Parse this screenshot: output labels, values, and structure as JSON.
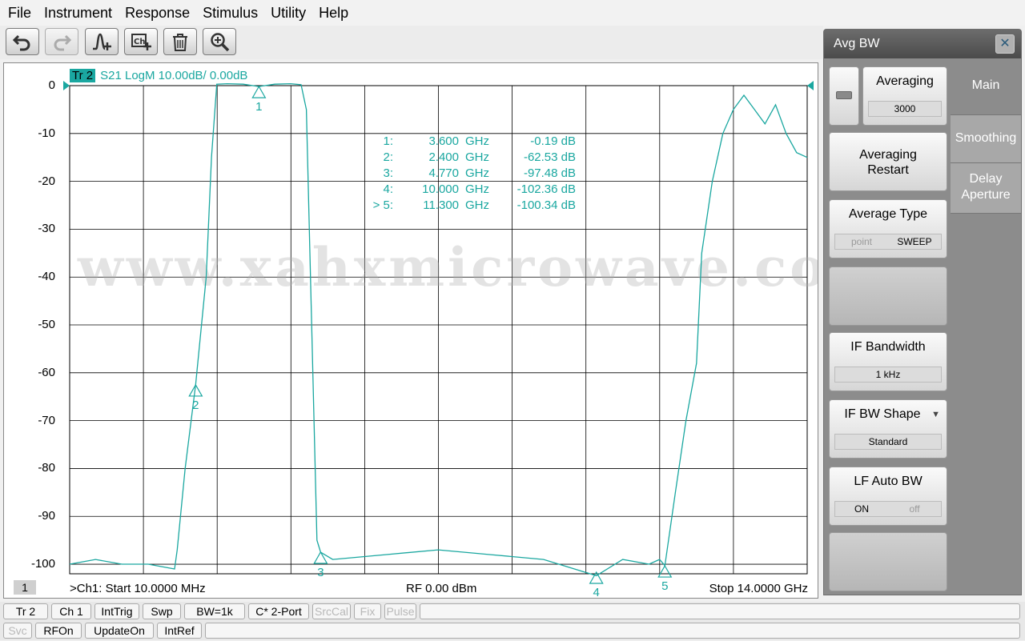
{
  "menu": [
    "File",
    "Instrument",
    "Response",
    "Stimulus",
    "Utility",
    "Help"
  ],
  "toolbar": {
    "buttons": [
      {
        "name": "undo",
        "icon": "undo-arrow-icon"
      },
      {
        "name": "redo",
        "icon": "redo-arrow-icon"
      },
      {
        "name": "add-marker",
        "icon": "marker-plus-icon"
      },
      {
        "name": "add-channel",
        "icon": "channel-plus-icon"
      },
      {
        "name": "delete",
        "icon": "trash-icon"
      },
      {
        "name": "zoom",
        "icon": "zoom-in-icon"
      }
    ]
  },
  "trace": {
    "tag": "Tr 2",
    "description": "S21 LogM 10.00dB/  0.00dB",
    "color": "#1aa7a0"
  },
  "chart_data": {
    "type": "line",
    "x_unit": "GHz",
    "y_unit": "dB",
    "xlim": [
      0.01,
      14.0
    ],
    "ylim": [
      -102,
      0
    ],
    "y_ticks": [
      "0",
      "-10",
      "-20",
      "-30",
      "-40",
      "-50",
      "-60",
      "-70",
      "-80",
      "-90",
      "-100"
    ],
    "y_tick_values": [
      0,
      -10,
      -20,
      -30,
      -40,
      -50,
      -60,
      -70,
      -80,
      -90,
      -100
    ],
    "x_divisions": 10,
    "grid": true,
    "series": [
      {
        "x": [
          0.01,
          0.5,
          1.0,
          1.5,
          2.0,
          2.05,
          2.2,
          2.4,
          2.6,
          2.7,
          2.8,
          3.0,
          3.3,
          3.6,
          3.9,
          4.2,
          4.4,
          4.5,
          4.6,
          4.7,
          4.77,
          5.0,
          6.0,
          7.0,
          8.0,
          9.0,
          10.0,
          10.5,
          11.0,
          11.2,
          11.3,
          11.5,
          11.7,
          11.9,
          12.0,
          12.2,
          12.4,
          12.6,
          12.8,
          13.0,
          13.2,
          13.4,
          13.6,
          13.8,
          14.0
        ],
        "y": [
          -100,
          -99,
          -100,
          -100,
          -101,
          -97,
          -80,
          -62.5,
          -40,
          -15,
          0.3,
          0.4,
          0.3,
          -0.19,
          0.3,
          0.4,
          0.2,
          -5,
          -50,
          -95,
          -97.5,
          -99,
          -98,
          -97,
          -98,
          -99,
          -102.4,
          -99,
          -100,
          -99,
          -100.3,
          -85,
          -70,
          -58,
          -35,
          -20,
          -10,
          -5,
          -2,
          -5,
          -8,
          -4,
          -10,
          -14,
          -15
        ]
      }
    ],
    "markers": [
      {
        "id": "1:",
        "label": "1",
        "freq": "3.600",
        "unit": "GHz",
        "value": "-0.19 dB",
        "x": 3.6,
        "y": -0.19
      },
      {
        "id": "2:",
        "label": "2",
        "freq": "2.400",
        "unit": "GHz",
        "value": "-62.53 dB",
        "x": 2.4,
        "y": -62.53
      },
      {
        "id": "3:",
        "label": "3",
        "freq": "4.770",
        "unit": "GHz",
        "value": "-97.48 dB",
        "x": 4.77,
        "y": -97.48
      },
      {
        "id": "4:",
        "label": "4",
        "freq": "10.000",
        "unit": "GHz",
        "value": "-102.36 dB",
        "x": 10.0,
        "y": -102.36
      },
      {
        "id": "> 5:",
        "label": "5",
        "freq": "11.300",
        "unit": "GHz",
        "value": "-100.34 dB",
        "x": 11.3,
        "y": -100.34
      }
    ]
  },
  "watermark": "www.xahxmicrowave.com",
  "status": {
    "channel_number": "1",
    "start": ">Ch1:  Start   10.0000 MHz",
    "rf": "RF    0.00 dBm",
    "stop": "Stop  14.0000 GHz"
  },
  "panel": {
    "title": "Avg BW",
    "close_icon": "close-icon",
    "tabs": [
      "Main",
      "Smoothing",
      "Delay Aperture"
    ],
    "averaging": {
      "label": "Averaging",
      "value": "3000"
    },
    "averaging_restart": "Averaging Restart",
    "average_type": {
      "label": "Average Type",
      "options": [
        "point",
        "SWEEP"
      ],
      "selected": "SWEEP"
    },
    "if_bandwidth": {
      "label": "IF Bandwidth",
      "value": "1 kHz"
    },
    "if_bw_shape": {
      "label": "IF BW Shape",
      "value": "Standard"
    },
    "lf_auto_bw": {
      "label": "LF Auto BW",
      "options": [
        "ON",
        "off"
      ],
      "selected": "ON"
    }
  },
  "statusbar": {
    "row1": [
      {
        "label": "Tr 2",
        "enabled": true
      },
      {
        "label": "Ch 1",
        "enabled": true
      },
      {
        "label": "IntTrig",
        "enabled": true
      },
      {
        "label": "Swp",
        "enabled": true
      },
      {
        "label": "BW=1k",
        "enabled": true
      },
      {
        "label": "C* 2-Port",
        "enabled": true
      },
      {
        "label": "SrcCal",
        "enabled": false
      },
      {
        "label": "Fix",
        "enabled": false
      },
      {
        "label": "Pulse",
        "enabled": false
      }
    ],
    "row2": [
      {
        "label": "Svc",
        "enabled": false
      },
      {
        "label": "RFOn",
        "enabled": true
      },
      {
        "label": "UpdateOn",
        "enabled": true
      },
      {
        "label": "IntRef",
        "enabled": true
      }
    ]
  }
}
